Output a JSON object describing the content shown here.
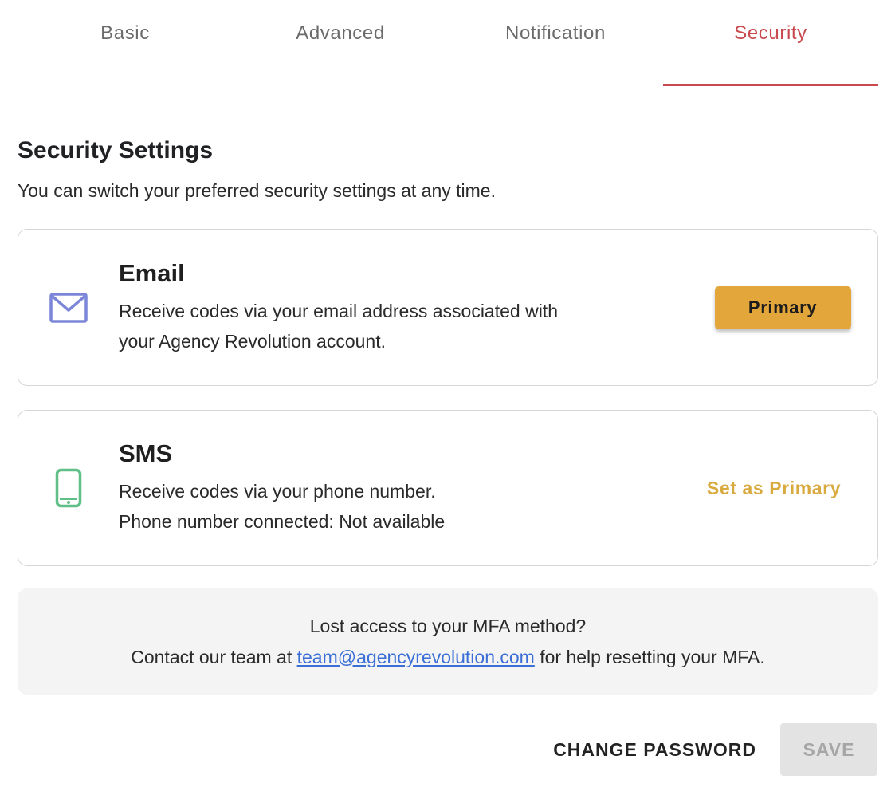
{
  "tabs": [
    {
      "label": "Basic",
      "active": false
    },
    {
      "label": "Advanced",
      "active": false
    },
    {
      "label": "Notification",
      "active": false
    },
    {
      "label": "Security",
      "active": true
    }
  ],
  "header": {
    "title": "Security Settings",
    "description": "You can switch your preferred security settings at any time."
  },
  "methods": {
    "email": {
      "icon": "email-icon",
      "title": "Email",
      "line1": "Receive codes via your email address associated with",
      "line2": "your Agency Revolution account.",
      "action_label": "Primary"
    },
    "sms": {
      "icon": "phone-icon",
      "title": "SMS",
      "line1": "Receive codes via your phone number.",
      "line2": "Phone number connected: Not available",
      "action_label": "Set as Primary"
    }
  },
  "help": {
    "line1": "Lost access to your MFA method?",
    "line2_prefix": "Contact our team at",
    "email": "team@agencyrevolution.com",
    "line2_suffix": "for help resetting your MFA."
  },
  "footer": {
    "change_password_label": "CHANGE PASSWORD",
    "save_label": "SAVE"
  },
  "colors": {
    "accent": "#c84a4f",
    "primary_button": "#e2a63a",
    "email_icon": "#7b86d8",
    "phone_icon": "#5fbf86",
    "link": "#3b6fd6"
  }
}
